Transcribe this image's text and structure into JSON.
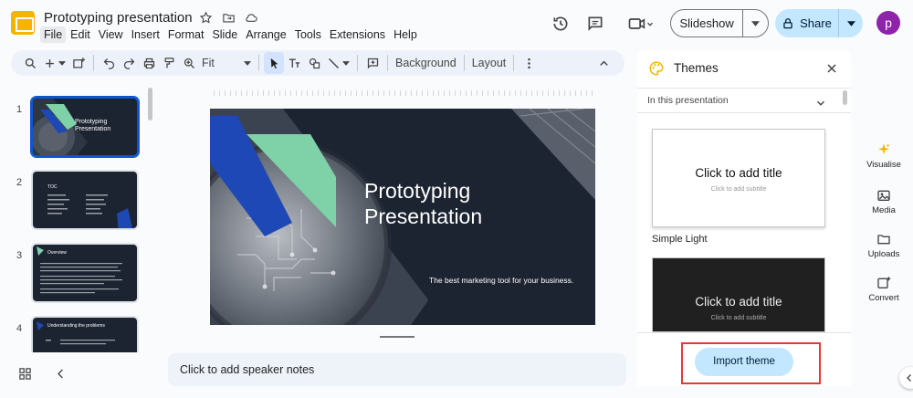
{
  "header": {
    "title": "Prototyping presentation",
    "menu": [
      "File",
      "Edit",
      "View",
      "Insert",
      "Format",
      "Slide",
      "Arrange",
      "Tools",
      "Extensions",
      "Help"
    ],
    "slideshow_label": "Slideshow",
    "share_label": "Share",
    "avatar_letter": "p"
  },
  "toolbar": {
    "zoom_label": "Fit",
    "background_label": "Background",
    "layout_label": "Layout"
  },
  "filmstrip": {
    "slides": [
      {
        "num": "1",
        "title": "Prototyping Presentation"
      },
      {
        "num": "2",
        "title": "TOC"
      },
      {
        "num": "3",
        "title": "Overview"
      },
      {
        "num": "4",
        "title": "Understanding the problems"
      }
    ]
  },
  "slide": {
    "title": "Prototyping\nPresentation",
    "subtitle": "The best marketing tool for your business."
  },
  "notes": {
    "placeholder": "Click to add speaker notes"
  },
  "themes": {
    "panel_title": "Themes",
    "section_label": "In this presentation",
    "card_title": "Click to add title",
    "card_subtitle": "Click to add subtitle",
    "theme_1_name": "Simple Light",
    "import_label": "Import theme"
  },
  "rail": {
    "items": [
      "Visualise",
      "Media",
      "Uploads",
      "Convert"
    ]
  },
  "colors": {
    "accent_blue": "#0b57d0",
    "slide_bg": "#1c2331",
    "slide_green": "#7fd1a8",
    "slide_blue": "#1e48b5",
    "share_bg": "#c2e7ff",
    "highlight_red": "#e53935"
  }
}
